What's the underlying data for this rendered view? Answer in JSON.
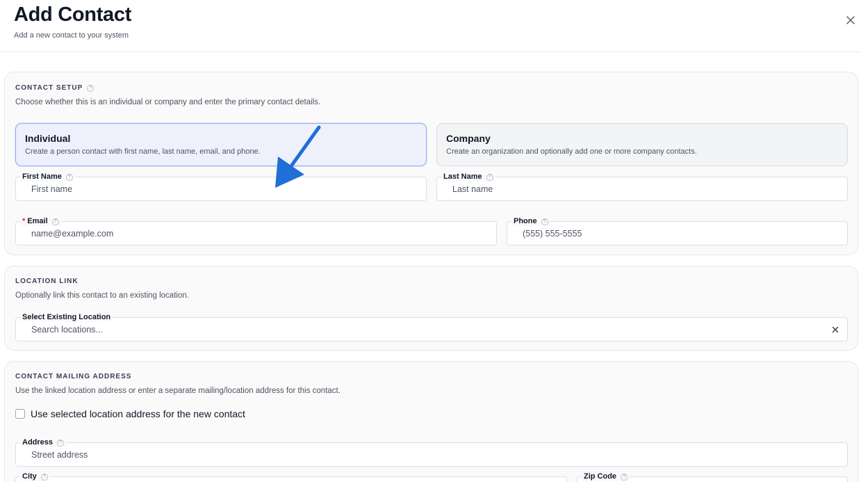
{
  "header": {
    "title": "Add Contact",
    "subtitle": "Add a new contact to your system"
  },
  "contact_setup": {
    "title": "CONTACT SETUP",
    "description": "Choose whether this is an individual or company and enter the primary contact details.",
    "individual": {
      "title": "Individual",
      "description": "Create a person contact with first name, last name, email, and phone."
    },
    "company": {
      "title": "Company",
      "description": "Create an organization and optionally add one or more company contacts."
    },
    "selected": "Individual",
    "first_name": {
      "label": "First Name",
      "placeholder": "First name",
      "value": ""
    },
    "last_name": {
      "label": "Last Name",
      "placeholder": "Last name",
      "value": ""
    },
    "email": {
      "label": "Email",
      "required_marker": "*",
      "placeholder": "name@example.com",
      "value": ""
    },
    "phone": {
      "label": "Phone",
      "placeholder": "(555) 555-5555",
      "value": ""
    }
  },
  "location_link": {
    "title": "LOCATION LINK",
    "description": "Optionally link this contact to an existing location.",
    "select": {
      "label": "Select Existing Location",
      "placeholder": "Search locations...",
      "value": ""
    }
  },
  "mailing_address": {
    "title": "CONTACT MAILING ADDRESS",
    "description": "Use the linked location address or enter a separate mailing/location address for this contact.",
    "use_location_checkbox": {
      "label": "Use selected location address for the new contact",
      "checked": false
    },
    "address": {
      "label": "Address",
      "placeholder": "Street address",
      "value": ""
    },
    "city": {
      "label": "City"
    },
    "zip": {
      "label": "Zip Code"
    }
  },
  "annotation": {
    "color": "#1f6fd6"
  },
  "colors": {
    "selected_border": "#9aaaf0",
    "selected_bg": "#eef1fc",
    "required": "#dc2626"
  },
  "icons": {
    "close": "close-icon",
    "help": "help-circle-icon",
    "clear": "clear-x-icon"
  }
}
